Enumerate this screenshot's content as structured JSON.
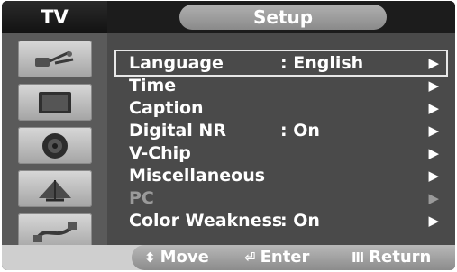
{
  "header": {
    "left_title": "TV",
    "title": "Setup"
  },
  "sidebar": {
    "icons": [
      "antenna-icon",
      "picture-icon",
      "speaker-icon",
      "satellite-dish-icon",
      "connection-cable-icon"
    ]
  },
  "menu": {
    "items": [
      {
        "label": "Language",
        "value": ": English",
        "arrow": "▶",
        "state": "selected"
      },
      {
        "label": "Time",
        "value": "",
        "arrow": "▶",
        "state": "normal"
      },
      {
        "label": "Caption",
        "value": "",
        "arrow": "▶",
        "state": "normal"
      },
      {
        "label": "Digital NR",
        "value": ": On",
        "arrow": "▶",
        "state": "normal"
      },
      {
        "label": "V-Chip",
        "value": "",
        "arrow": "▶",
        "state": "normal"
      },
      {
        "label": "Miscellaneous",
        "value": "",
        "arrow": "▶",
        "state": "normal"
      },
      {
        "label": "PC",
        "value": "",
        "arrow": "▶",
        "state": "disabled"
      },
      {
        "label": "Color Weakness",
        "value": ": On",
        "arrow": "▶",
        "state": "normal"
      }
    ]
  },
  "footer": {
    "move": {
      "glyph": "⬍",
      "label": "Move"
    },
    "enter": {
      "glyph": "⏎",
      "label": "Enter"
    },
    "return": {
      "glyph": "Ⅲ",
      "label": "Return"
    }
  },
  "colors": {
    "frame": "#3f3f3f",
    "sidebar": "#5a5a5a",
    "menu_bg": "#4a4a4a",
    "text": "#ffffff",
    "disabled_text": "#9a9a9a"
  }
}
